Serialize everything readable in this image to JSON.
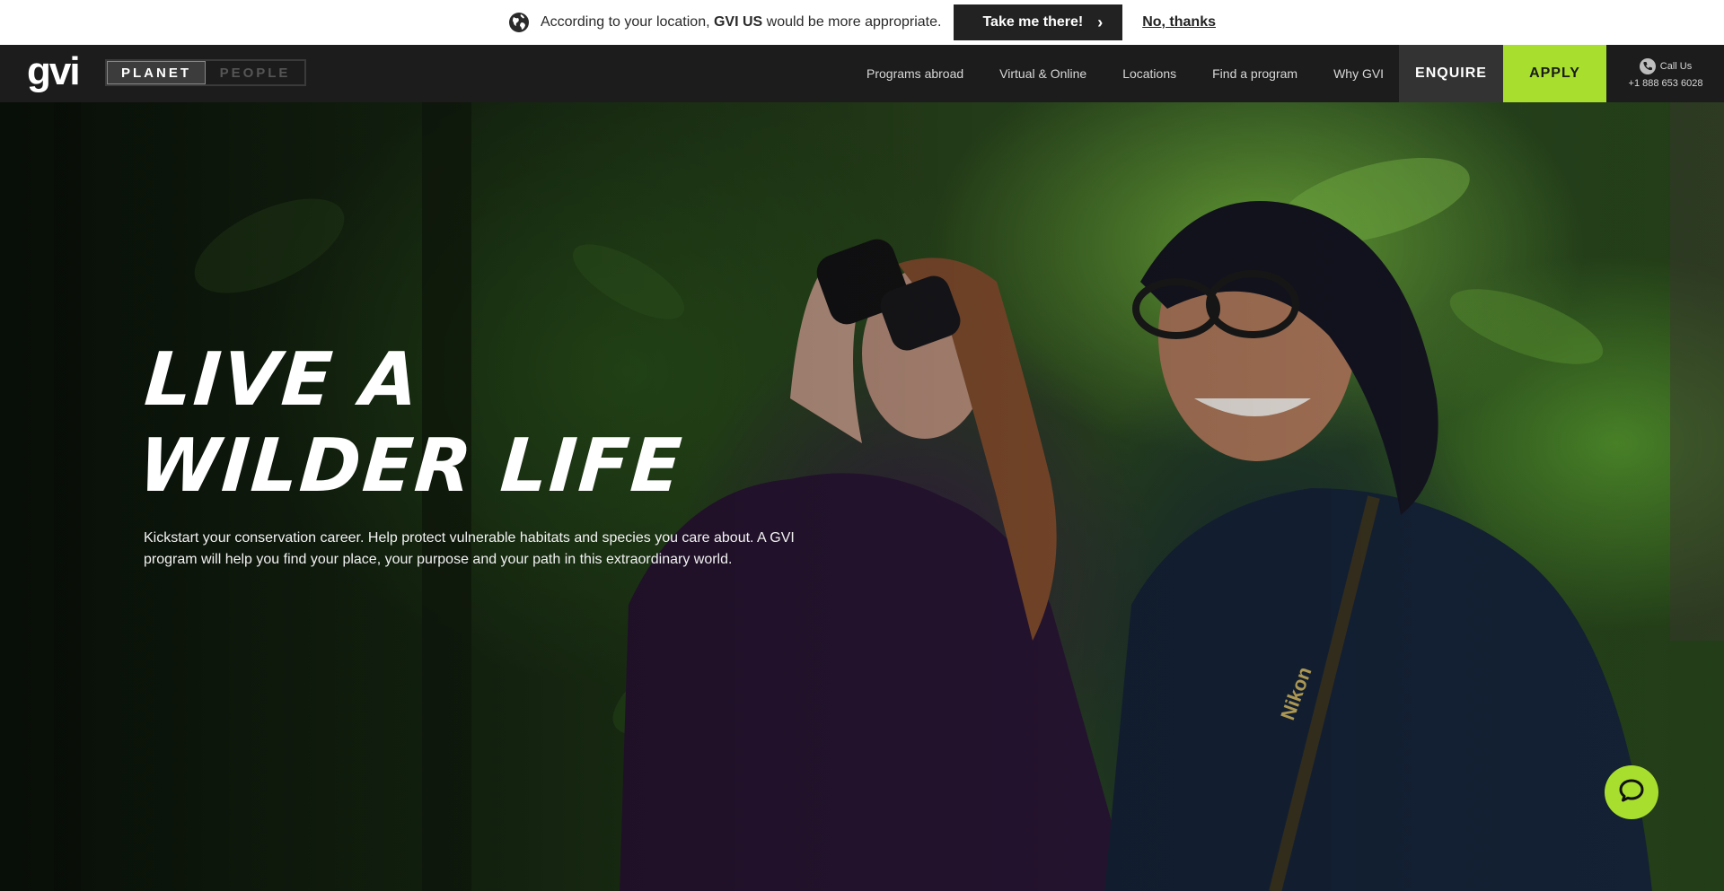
{
  "geo_banner": {
    "text_prefix": "According to your location,",
    "brand": "GVI US",
    "text_suffix": "would be more appropriate.",
    "take_me_label": "Take me there!",
    "no_thanks_label": "No, thanks",
    "globe_icon": "globe-icon"
  },
  "nav": {
    "logo": "gvi",
    "toggle": {
      "planet": "PLANET",
      "people": "PEOPLE"
    },
    "links": [
      "Programs abroad",
      "Virtual & Online",
      "Locations",
      "Find a program",
      "Why GVI"
    ],
    "enquire_label": "ENQUIRE",
    "apply_label": "APPLY",
    "call_label": "Call Us",
    "phone": "+1 888 653 6028",
    "colors": {
      "apply_bg": "#a8df2e",
      "enquire_bg": "#333333",
      "nav_bg": "#1c1c1c"
    }
  },
  "hero": {
    "headline_line1": "LIVE A",
    "headline_line2": "WILDER LIFE",
    "subtext": "Kickstart your conservation career. Help protect vulnerable habitats and species you care about. A GVI program will help you find your place, your purpose and your path in this extraordinary world."
  },
  "chat": {
    "icon": "chat-icon"
  }
}
